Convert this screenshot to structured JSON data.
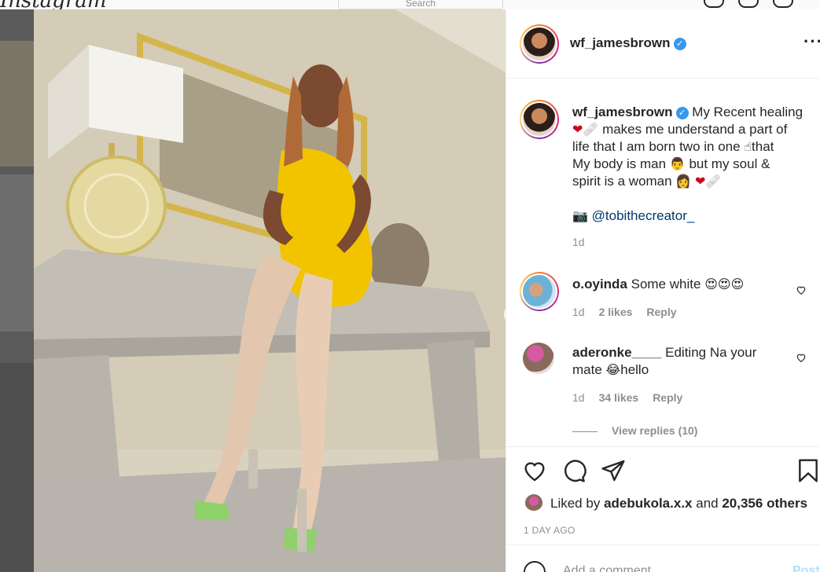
{
  "background": {
    "logo_text": "Instagram",
    "search_placeholder": "Search"
  },
  "post": {
    "author": "wf_jamesbrown",
    "verified": true,
    "more_icon": "more-options-icon",
    "caption_line1": "My Recent healing",
    "caption_line2": "makes me understand a part of",
    "caption_line3": "life that I am born two in one",
    "caption_line3b": "that",
    "caption_line4": "My body is man",
    "caption_line4b": "but my soul &",
    "caption_line5": "spirit is a woman",
    "caption_emojis": {
      "heart": "❤",
      "bandage": "🩹",
      "pointing": "☝",
      "man": "👨",
      "woman": "👩",
      "camera": "📷",
      "heart_eyes": "😍",
      "laughing": "😂"
    },
    "photo_credit": "@tobithecreator_",
    "caption_time": "1d"
  },
  "comments": [
    {
      "user": "o.oyinda",
      "text": "Some white",
      "time": "1d",
      "likes": "2 likes",
      "reply": "Reply"
    },
    {
      "user": "aderonke____",
      "text_line1": "Editing Na your",
      "text_line2a": "mate",
      "text_line2b": "hello",
      "time": "1d",
      "likes": "34 likes",
      "reply": "Reply",
      "view_replies": "View replies (10)"
    }
  ],
  "engagement": {
    "liked_by_prefix": "Liked by",
    "liked_by_user": "adebukola.x.x",
    "liked_by_and": "and",
    "others": "20,356 others",
    "date": "1 DAY AGO"
  },
  "comment_input": {
    "placeholder": "Add a comment...",
    "post_label": "Post"
  },
  "colors": {
    "verified": "#3897f0",
    "mention": "#00376b",
    "muted": "#8e8e8e",
    "dress": "#f2c400"
  }
}
